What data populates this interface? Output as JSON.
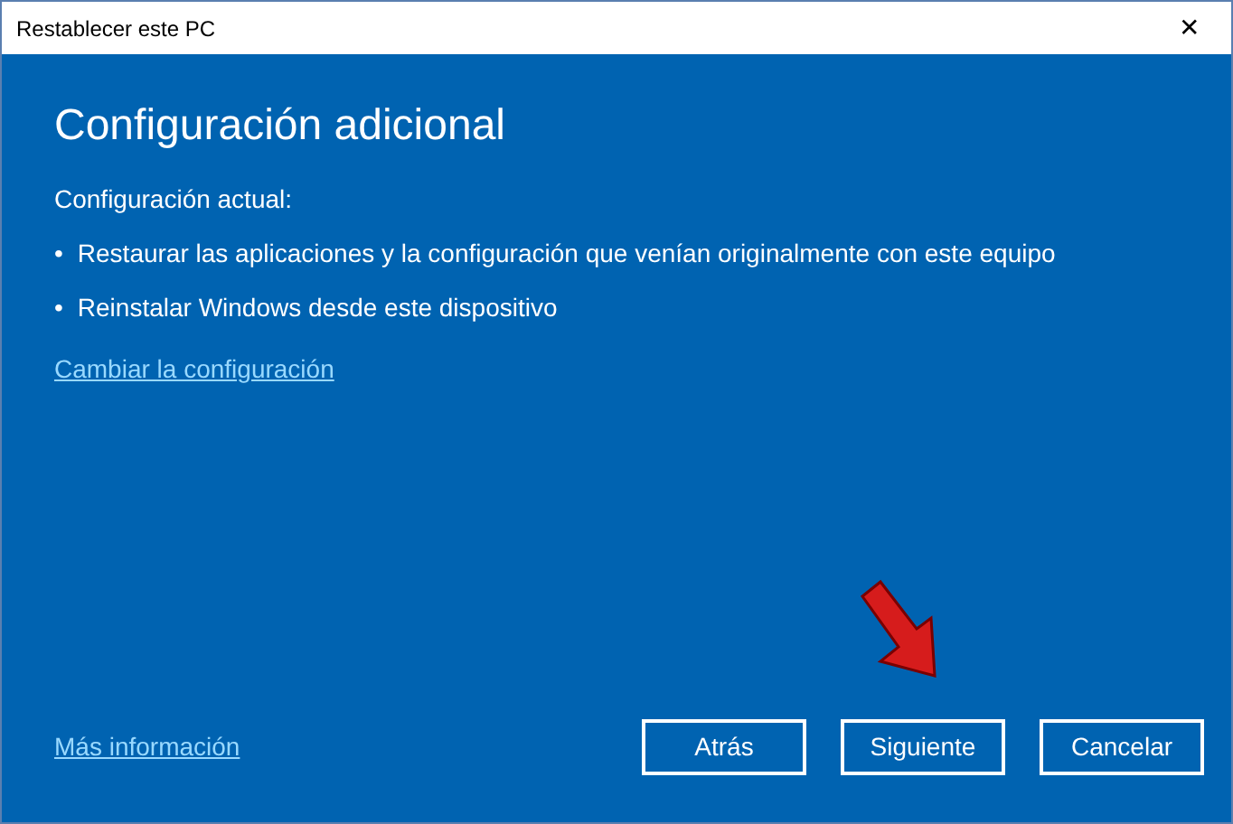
{
  "window": {
    "title": "Restablecer este PC",
    "close": "✕"
  },
  "heading": "Configuración adicional",
  "current_label": "Configuración actual:",
  "settings": [
    "Restaurar las aplicaciones y la configuración que venían originalmente con este equipo",
    "Reinstalar Windows desde este dispositivo"
  ],
  "bullet": "•",
  "change_link": "Cambiar la configuración",
  "more_info_link": "Más información",
  "buttons": [
    {
      "label": "Atrás"
    },
    {
      "label": "Siguiente"
    },
    {
      "label": "Cancelar"
    }
  ]
}
